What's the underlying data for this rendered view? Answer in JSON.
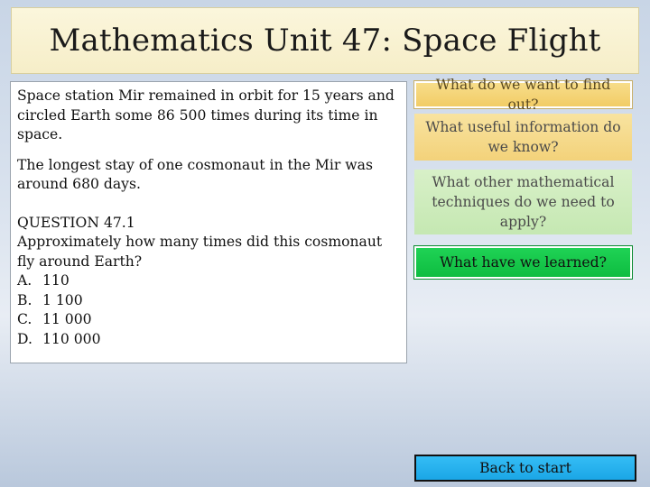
{
  "slide": {
    "title": "Mathematics Unit 47: Space Flight"
  },
  "content": {
    "paragraph1": "Space station Mir remained in orbit for 15 years and circled Earth some 86 500 times during its time in space.",
    "paragraph2": "The longest stay of one cosmonaut in the Mir was around 680 days.",
    "question_title": "QUESTION 47.1",
    "question_text": "Approximately how many times did this cosmonaut fly around Earth?",
    "options": [
      {
        "letter": "A.",
        "value": "110"
      },
      {
        "letter": "B.",
        "value": "1 100"
      },
      {
        "letter": "C.",
        "value": "11 000"
      },
      {
        "letter": "D.",
        "value": "110 000"
      }
    ]
  },
  "buttons": {
    "find_out": "What do we want to find out?",
    "useful_info": "What useful information do we know?",
    "techniques": "What other mathematical techniques do we need to apply?",
    "learned": "What have we learned?",
    "back": "Back to start"
  },
  "colors": {
    "title_bg": "#f6eec8",
    "find_out_bg": "#f2cc66",
    "useful_info_bg": "#f3d27a",
    "techniques_bg": "#c5e8b2",
    "learned_bg": "#0ebd40",
    "back_bg": "#1ba6e6"
  }
}
